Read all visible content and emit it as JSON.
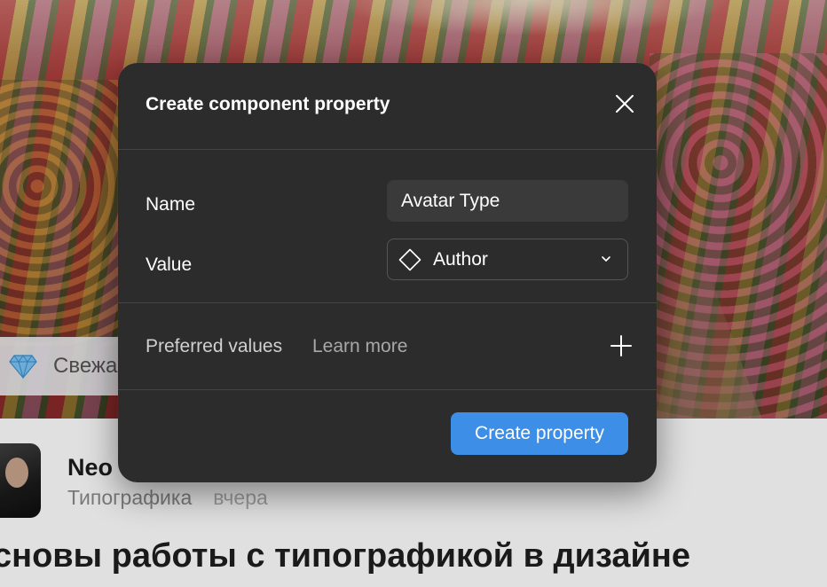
{
  "background": {
    "tag_text": "Свежа",
    "author_name": "Neo",
    "author_category": "Типографика",
    "author_date": "вчера",
    "article_title": "сновы работы с типографикой в дизайне"
  },
  "modal": {
    "title": "Create component property",
    "name_label": "Name",
    "name_value": "Avatar Type",
    "value_label": "Value",
    "value_selected": "Author",
    "preferred_label": "Preferred values",
    "learn_more": "Learn more",
    "create_label": "Create property"
  },
  "icons": {
    "close": "close-icon",
    "component": "component-diamond-icon",
    "chevron": "chevron-down-icon",
    "add": "plus-icon",
    "gem": "gem-icon"
  },
  "colors": {
    "modal_bg": "#2c2c2c",
    "input_bg": "#3a3a3a",
    "primary_button": "#3d8ee6",
    "divider": "#444444"
  }
}
